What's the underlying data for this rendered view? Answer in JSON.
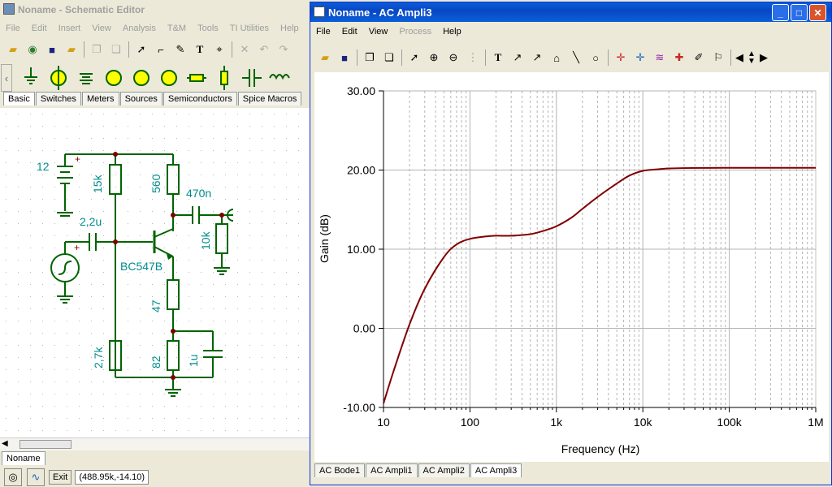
{
  "schematic": {
    "title": "Noname - Schematic Editor",
    "menu": [
      "File",
      "Edit",
      "Insert",
      "View",
      "Analysis",
      "T&M",
      "Tools",
      "TI Utilities",
      "Help"
    ],
    "component_tabs": [
      "Basic",
      "Switches",
      "Meters",
      "Sources",
      "Semiconductors",
      "Spice Macros"
    ],
    "doc_tab": "Noname",
    "exit_label": "Exit",
    "status_coords": "(488.95k,-14.10)",
    "components": {
      "v_source": "12",
      "r_bias_top": "15k",
      "r_collector": "560",
      "c_out": "470n",
      "c_in": "2,2u",
      "r_load": "10k",
      "transistor": "BC547B",
      "r_emitter1": "47",
      "r_bias_bottom": "2,7k",
      "r_emitter2": "82",
      "c_emitter": "1u"
    }
  },
  "analysis": {
    "title": "Noname - AC Ampli3",
    "menu": [
      "File",
      "Edit",
      "View",
      "Process",
      "Help"
    ],
    "tabs": [
      "AC Bode1",
      "AC Ampli1",
      "AC Ampli2",
      "AC Ampli3"
    ]
  },
  "chart_data": {
    "type": "line",
    "xlabel": "Frequency (Hz)",
    "ylabel": "Gain (dB)",
    "x_scale": "log",
    "xlim": [
      10,
      1000000
    ],
    "ylim": [
      -10,
      30
    ],
    "x_ticks": [
      "10",
      "100",
      "1k",
      "10k",
      "100k",
      "1M"
    ],
    "y_ticks": [
      "-10.00",
      "0.00",
      "10.00",
      "20.00",
      "30.00"
    ],
    "grid": true,
    "line_color": "#800000",
    "series": [
      {
        "x": [
          10,
          13,
          20,
          30,
          50,
          70,
          100,
          150,
          200,
          300,
          500,
          700,
          1000,
          1500,
          2000,
          3000,
          5000,
          7000,
          10000,
          15000,
          20000,
          30000,
          50000,
          100000,
          1000000
        ],
        "y": [
          -9.5,
          -5.5,
          0.5,
          5.0,
          9.0,
          10.6,
          11.3,
          11.6,
          11.7,
          11.7,
          11.9,
          12.3,
          12.9,
          14.0,
          15.1,
          16.6,
          18.3,
          19.3,
          19.9,
          20.1,
          20.2,
          20.25,
          20.27,
          20.28,
          20.28
        ]
      }
    ]
  }
}
